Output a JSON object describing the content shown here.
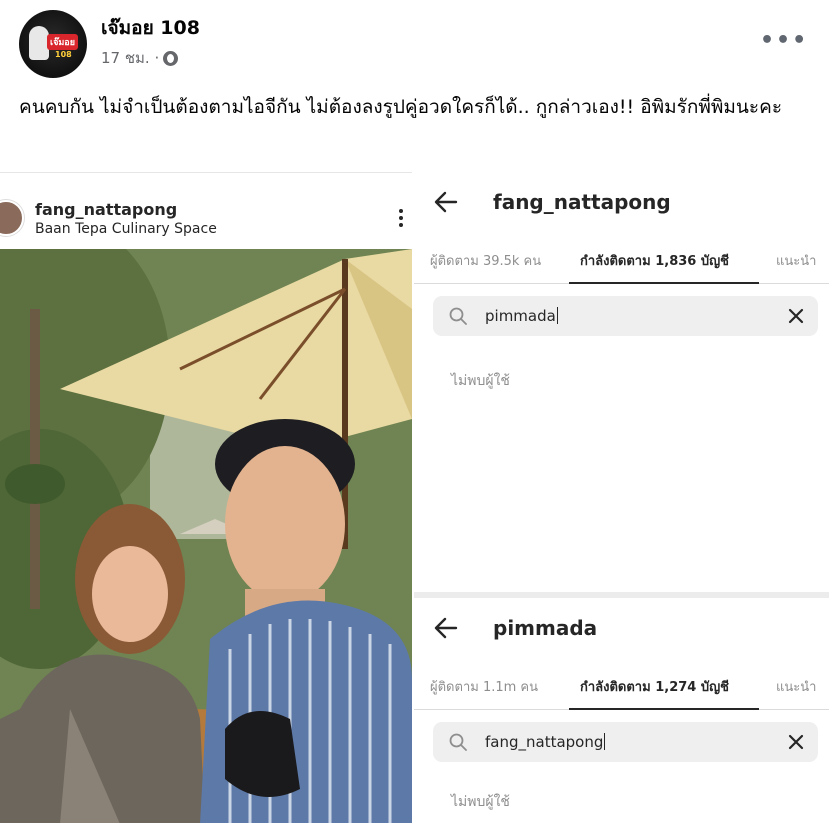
{
  "post": {
    "page_name": "เจ๊มอย 108",
    "time": "17 ชม. ·",
    "more_label": "•••",
    "caption": "คนคบกัน ไม่จำเป็นต้องตามไอจีกัน ไม่ต้องลงรูปคู่อวดใครก็ได้.. กูกล่าวเอง!! อิพิมรักพี่พิมนะคะ",
    "avatar_text": "เจ๊มอย",
    "avatar_num": "108"
  },
  "photo_post": {
    "username": "fang_nattapong",
    "location": "Baan Tepa Culinary Space"
  },
  "panels": [
    {
      "title": "fang_nattapong",
      "tabs": [
        "ผู้ติดตาม 39.5k คน",
        "กำลังติดตาม 1,836 บัญชี",
        "แนะนำ"
      ],
      "active_tab": 1,
      "search_value": "pimmada",
      "empty_message": "ไม่พบผู้ใช้"
    },
    {
      "title": "pimmada",
      "tabs": [
        "ผู้ติดตาม 1.1m คน",
        "กำลังติดตาม 1,274 บัญชี",
        "แนะนำ"
      ],
      "active_tab": 1,
      "search_value": "fang_nattapong",
      "empty_message": "ไม่พบผู้ใช้"
    }
  ],
  "colors": {
    "text_primary": "#050505",
    "text_secondary": "#65676b",
    "ig_text": "#262626",
    "ig_muted": "#8e8e8e",
    "search_bg": "#efefef"
  },
  "icons": [
    "globe-icon",
    "more-icon",
    "back-arrow-icon",
    "search-icon",
    "clear-icon",
    "kebab-icon"
  ]
}
